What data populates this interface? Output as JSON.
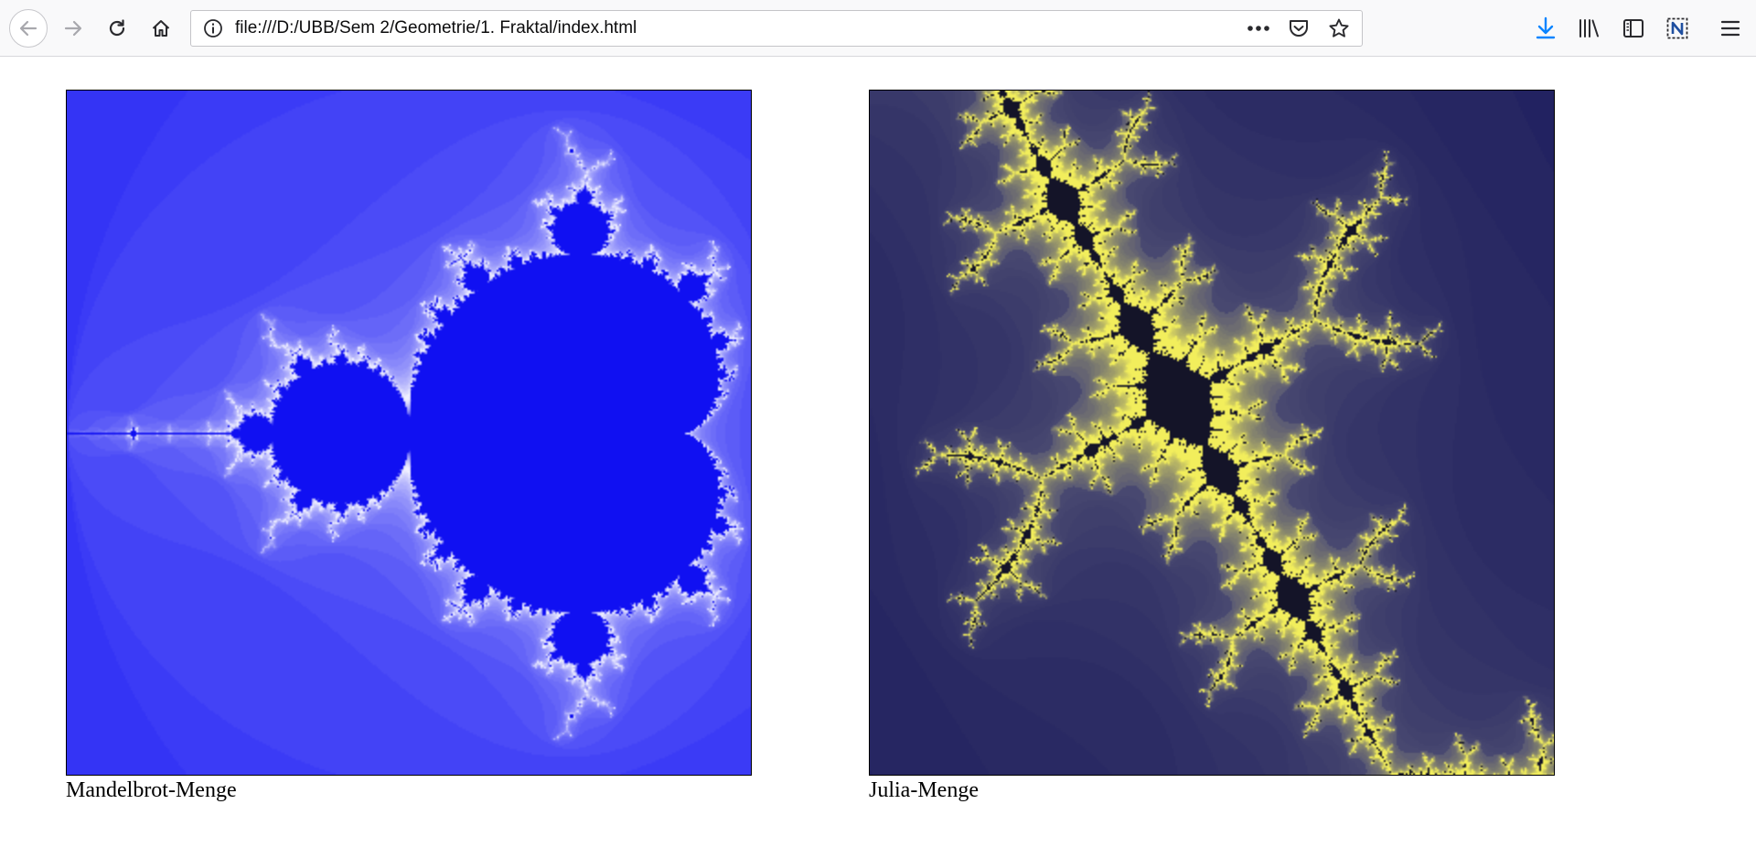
{
  "browser": {
    "url": "file:///D:/UBB/Sem 2/Geometrie/1. Fraktal/index.html",
    "icons": [
      "back-arrow-icon",
      "forward-arrow-icon",
      "reload-icon",
      "home-icon",
      "info-icon",
      "more-dots-icon",
      "pocket-icon",
      "star-bookmark-icon",
      "download-arrow-icon",
      "library-icon",
      "sidebar-icon",
      "extension-n-icon",
      "hamburger-menu-icon"
    ],
    "accent_color": "#0a84ff"
  },
  "page": {
    "fractals": [
      {
        "caption": "Mandelbrot-Menge",
        "colors": {
          "set": "#1010f2",
          "outside": "#2d2df5",
          "edge": "#f0f0ff"
        }
      },
      {
        "caption": "Julia-Menge",
        "colors": {
          "background": "#1c1c5e",
          "band": "#555575",
          "fractal": "#f2ee5c"
        }
      }
    ]
  }
}
